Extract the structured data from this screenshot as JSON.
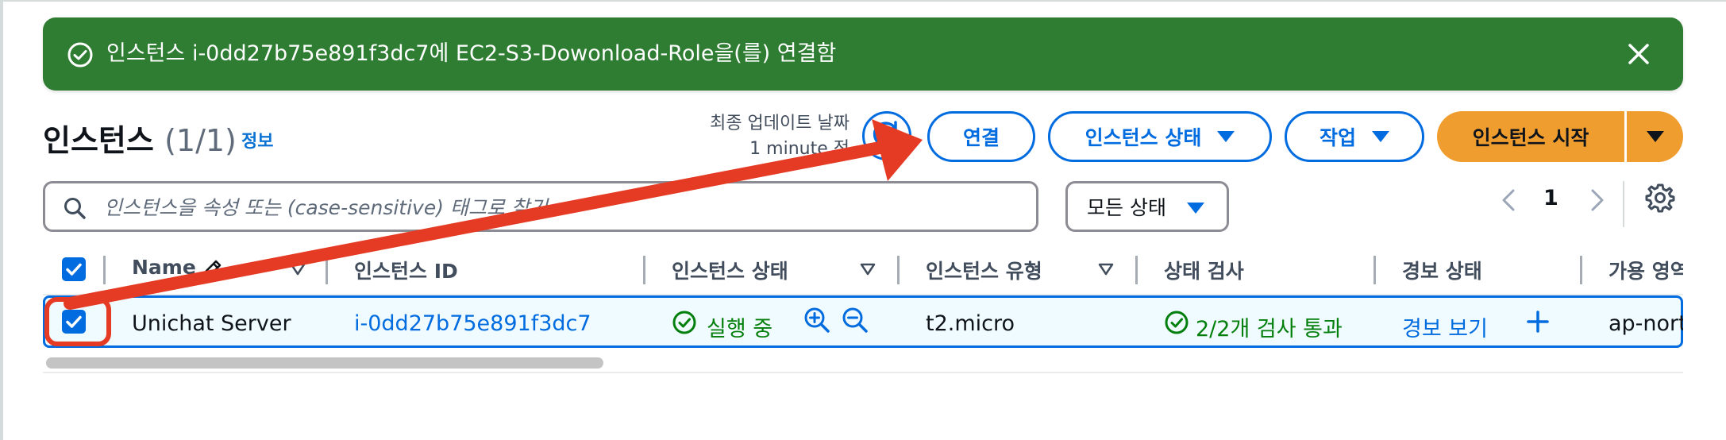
{
  "flash": {
    "message": "인스턴스 i-0dd27b75e891f3dc7에 EC2-S3-Dowonload-Role을(를) 연결함",
    "color": "#2e7d32"
  },
  "header": {
    "title": "인스턴스",
    "count": "(1/1)",
    "info": "정보",
    "last_update_label": "최종 업데이트 날짜",
    "last_update_value": "1 minute 전",
    "connect_label": "연결",
    "instance_state_label": "인스턴스 상태",
    "actions_label": "작업",
    "launch_label": "인스턴스 시작"
  },
  "filter": {
    "search_placeholder": "인스턴스을 속성 또는 (case-sensitive) 태그로 찾기",
    "status_filter": "모든 상태",
    "page": "1"
  },
  "table": {
    "columns": [
      "Name",
      "인스턴스 ID",
      "인스턴스 상태",
      "인스턴스 유형",
      "상태 검사",
      "경보 상태",
      "가용 영역"
    ],
    "rows": [
      {
        "selected": true,
        "name": "Unichat Server",
        "instance_id": "i-0dd27b75e891f3dc7",
        "state": "실행 중",
        "type": "t2.micro",
        "status_check": "2/2개 검사 통과",
        "alarm": "경보 보기",
        "az": "ap-north"
      }
    ]
  },
  "colors": {
    "accent": "#006ce0",
    "launch": "#f09d30",
    "success": "#037f0c",
    "annotation": "#e53a24"
  }
}
